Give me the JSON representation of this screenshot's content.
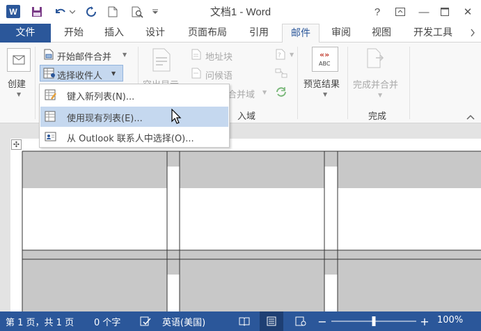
{
  "app": {
    "logo_letter": "W",
    "title": "文档1 - Word"
  },
  "window": {
    "help": "?",
    "restore": "⧉",
    "minimize": "—",
    "close": "✕"
  },
  "tabs": [
    "文件",
    "开始",
    "插入",
    "设计",
    "页面布局",
    "引用",
    "邮件",
    "审阅",
    "视图",
    "开发工具"
  ],
  "active_tab": "邮件",
  "ribbon": {
    "create_label": "创建",
    "start_merge_label": "开始邮件合并",
    "select_recipients_label": "选择收件人",
    "highlight_fields_label": "突出显示",
    "address_block_label": "地址块",
    "greeting_line_label": "问候语",
    "insert_merge_field_label": "合并域",
    "insert_fields_group": "入域",
    "preview_results_label": "预览结果",
    "abc_text": "ABC",
    "finish_merge_label": "完成并合并",
    "finish_group": "完成"
  },
  "dropdown": {
    "items": [
      {
        "label": "键入新列表(N)...",
        "icon": "new-list-icon"
      },
      {
        "label": "使用现有列表(E)...",
        "icon": "existing-list-icon"
      },
      {
        "label": "从 Outlook 联系人中选择(O)...",
        "icon": "outlook-contacts-icon"
      }
    ]
  },
  "status": {
    "page": "第 1 页，共 1 页",
    "words": "0 个字",
    "language": "英语(美国)",
    "zoom": "100%",
    "zoom_level_percent": 100
  },
  "colors": {
    "accent": "#2b579a",
    "hover": "#c5d8ef",
    "table_shade": "#c8c8c8"
  }
}
